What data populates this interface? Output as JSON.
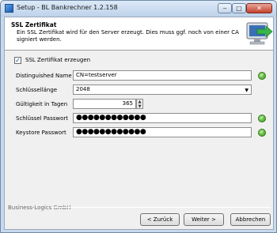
{
  "window": {
    "title": "Setup - BL Bankrechner 1.2.158",
    "controls": {
      "minimize": "‒",
      "maximize": "□",
      "close": "✕"
    }
  },
  "header": {
    "title": "SSL Zertifikat",
    "description": "Ein SSL Zertifikat wird für den Server erzeugt. Dies muss ggf. noch von einer CA signiert werden."
  },
  "form": {
    "checkbox": {
      "label": "SSL Zertifikat erzeugen",
      "checked": true,
      "mark": "✓"
    },
    "fields": {
      "dn": {
        "label": "Distinguished Name",
        "value": "CN=testserver"
      },
      "keylength": {
        "label": "Schlüssellänge",
        "value": "2048",
        "arrow": "▼"
      },
      "validity": {
        "label": "Gültigkeit in Tagen",
        "value": "365",
        "up": "▲",
        "down": "▼"
      },
      "keypassword": {
        "label": "Schlüssel Passwort",
        "value": "●●●●●●●●●●●●"
      },
      "keystorepassword": {
        "label": "Keystore Passwort",
        "value": "●●●●●●●●●●●●"
      }
    },
    "valid_mark": "✓"
  },
  "footer": {
    "brand": "Business-Logics GmbH",
    "back": "< Zurück",
    "next": "Weiter >",
    "cancel": "Abbrechen"
  }
}
